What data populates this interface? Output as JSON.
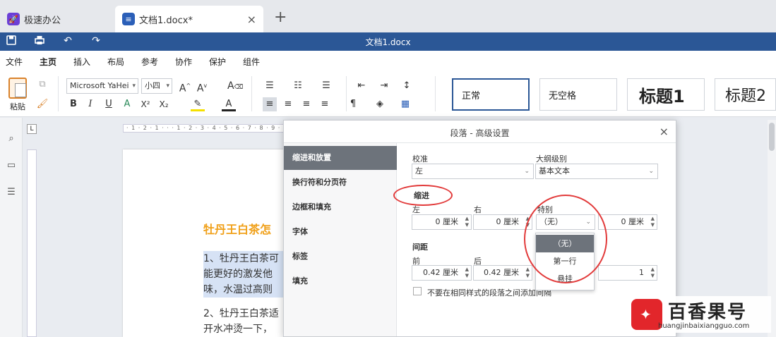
{
  "tabs": {
    "home": "极速办公",
    "doc": "文档1.docx*",
    "close": "×",
    "add": "+"
  },
  "titlebar": {
    "title": "文档1.docx"
  },
  "menu": [
    "文件",
    "主页",
    "插入",
    "布局",
    "参考",
    "协作",
    "保护",
    "组件"
  ],
  "ribbon": {
    "paste": "粘贴",
    "font_name": "Microsoft YaHei",
    "font_size": "小四",
    "bold": "B",
    "italic": "I",
    "underline": "U",
    "superscript": "X²",
    "subscript": "X₂",
    "pilcrow": "¶",
    "styles": [
      "正常",
      "无空格",
      "标题1",
      "标题2"
    ]
  },
  "ruler": {
    "marks": "· 1 · 2 · 1 · · · 1 · 2 · 3 · 4 · 5 · 6 · 7 · 8 · 9 · 10",
    "corner": "L"
  },
  "page": {
    "heading": "牡丹王白茶怎",
    "para1": [
      "1、牡丹王白茶可",
      "能更好的激发他",
      "味，水温过高则"
    ],
    "para2": [
      "2、牡丹王白茶适",
      "开水冲烫一下，"
    ]
  },
  "dialog": {
    "title": "段落 - 高级设置",
    "close": "×",
    "nav": [
      "缩进和放置",
      "换行符和分页符",
      "边框和填充",
      "字体",
      "标签",
      "填充"
    ],
    "alignment_label": "校准",
    "alignment_value": "左",
    "outline_label": "大纲级别",
    "outline_value": "基本文本",
    "indent_section": "缩进",
    "left_label": "左",
    "left_value": "0 厘米",
    "right_label": "右",
    "right_value": "0 厘米",
    "special_label": "特别",
    "special_value": "（无）",
    "special_by_value": "0 厘米",
    "spacing_section": "间距",
    "before_label": "前",
    "before_value": "0.42 厘米",
    "after_label": "后",
    "after_value": "0.42 厘米",
    "line_value": "1",
    "checkbox_label": "不要在相同样式的段落之间添加间隔"
  },
  "popup": {
    "options": [
      "（无）",
      "第一行",
      "悬挂"
    ],
    "selected_index": 0
  },
  "watermark": {
    "name": "百香果号",
    "url": "huangjinbaixiangguo.com"
  },
  "colors": {
    "titlebar": "#2b5796",
    "accent_orange": "#f0a019",
    "annotation_red": "#e23a3a"
  }
}
